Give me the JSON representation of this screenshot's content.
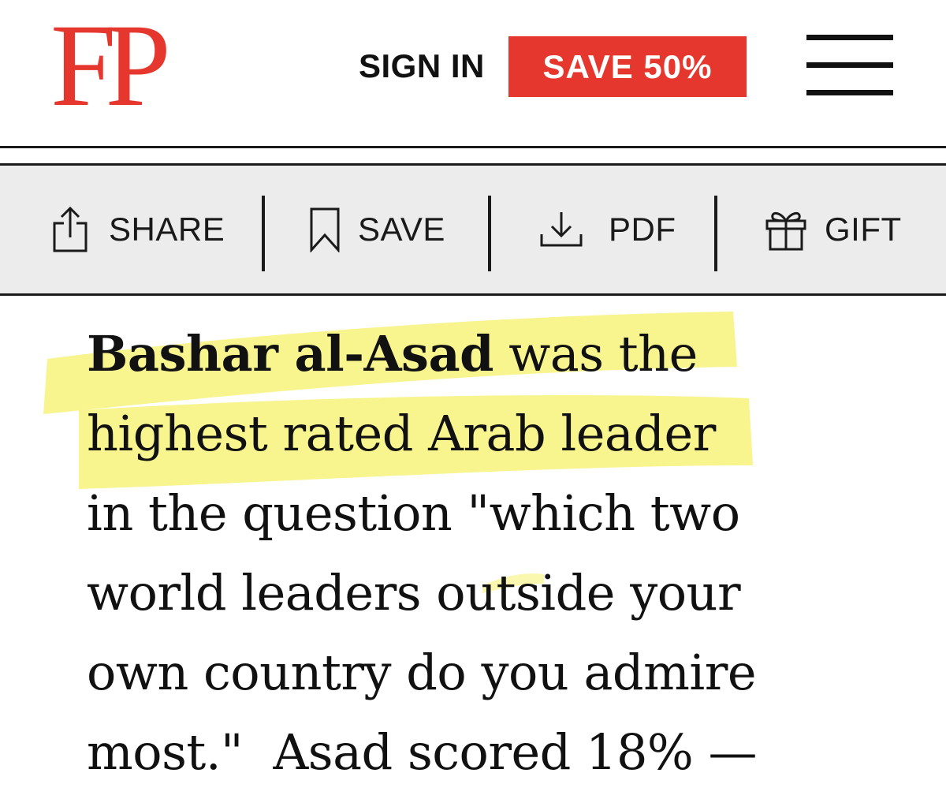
{
  "header": {
    "logo": "FP",
    "sign_in_label": "SIGN IN",
    "subscribe_label": "SAVE 50%",
    "menu_icon": "hamburger-menu-icon"
  },
  "action_bar": {
    "items": [
      {
        "label": "SHARE",
        "icon": "share-icon"
      },
      {
        "label": "SAVE",
        "icon": "bookmark-icon"
      },
      {
        "label": "PDF",
        "icon": "download-icon"
      },
      {
        "label": "GIFT",
        "icon": "gift-icon"
      }
    ]
  },
  "article": {
    "lead_name": "Bashar al-Asad",
    "line1_rest": " was the",
    "line2": "highest rated Arab leader",
    "line3": "in the question \"which two",
    "line4": "world leaders outside your",
    "line5": "own country do you admire",
    "line6": "most.\"  Asad scored 18% —"
  },
  "colors": {
    "brand_red": "#e5372d",
    "toolbar_bg": "#ececec",
    "highlight": "#f7f27a"
  }
}
